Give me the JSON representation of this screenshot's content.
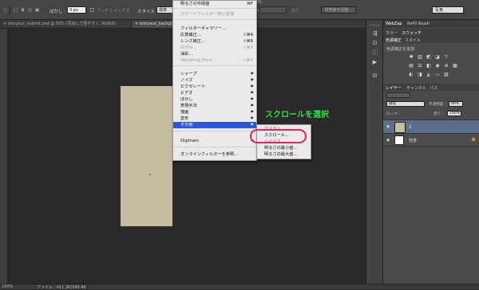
{
  "optbar": {
    "feather_label": "ぼかし :",
    "feather_value": "0 px",
    "antialias_label": "アンチエイリアス",
    "style_label": "スタイル :",
    "style_value": "標準",
    "width_label": "幅",
    "height_label": "高さ",
    "refine_edge": "境界線を調整...",
    "workspace": "写真",
    "tail": "SS"
  },
  "doc_tabs": [
    "storyauc_submit.psd @ 50% (見出しで見やすく, RGB/8)",
    "storyauc_backgrou"
  ],
  "filter_menu": {
    "top_item": {
      "label": "明るさの中間値",
      "shortcut": "⌘F"
    },
    "smart_filter": "スマートフィルター用に変換",
    "filter_gallery": "フィルターギャラリー...",
    "wide_angle": {
      "label": "広角補正...",
      "shortcut": "⇧⌘A"
    },
    "lens": {
      "label": "レンズ補正...",
      "shortcut": "⇧⌘R"
    },
    "liquify": {
      "label": "ゆがみ...",
      "shortcut": "⇧⌘X"
    },
    "oil": "油彩...",
    "vanishing": {
      "label": "Vanishing Point...",
      "shortcut": "⌥⌘V"
    },
    "submenus": [
      "シャープ",
      "ノイズ",
      "ピクセレート",
      "ビデオ",
      "ぼかし",
      "表現手法",
      "描画",
      "変形",
      "その他"
    ],
    "digimarc": "Digimarc",
    "browse_online": "オンラインフィルターを参照..."
  },
  "other_submenu": {
    "items": [
      "カスタム...",
      "スクロール...",
      "ハイパス...",
      "明るさの最小値...",
      "明るさの最大値..."
    ]
  },
  "annotation": "スクロールを選択",
  "panels": {
    "top_tabs": [
      "WebZap",
      "Reflll Readr"
    ],
    "color_tabs": [
      "カラー",
      "スウォッチ"
    ],
    "adjust_tabs": [
      "色調補正",
      "スタイル"
    ],
    "adjust_hint": "色調補正を追加",
    "layer_tabs": [
      "レイヤー",
      "チャンネル",
      "パス"
    ],
    "blend_mode": "通常",
    "opacity_label": "不透明度 :",
    "opacity_value": "99%",
    "lock_label": "ロック :",
    "fill_label": "塗り :",
    "fill_value": "100%",
    "layers": [
      {
        "name": "2"
      },
      {
        "name": "背景"
      }
    ]
  },
  "statusbar": {
    "zoom": "100%",
    "file_info": "ファイル : 411.3K/568.4K"
  },
  "colors": {
    "menu_highlight": "#2d57d8",
    "annotation_text": "#3ee64a",
    "annotation_ring": "#e0245e",
    "paper": "#c5bd9f"
  }
}
